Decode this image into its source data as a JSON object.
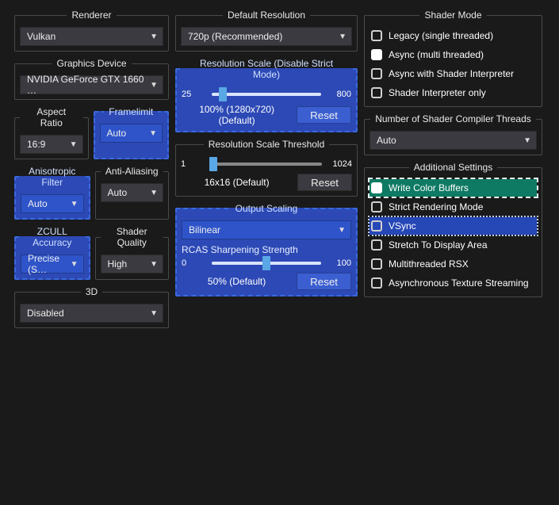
{
  "col1": {
    "renderer": {
      "legend": "Renderer",
      "value": "Vulkan"
    },
    "graphics_device": {
      "legend": "Graphics Device",
      "value": "NVIDIA GeForce GTX 1660 …"
    },
    "aspect": {
      "legend": "Aspect Ratio",
      "value": "16:9"
    },
    "framelimit": {
      "legend": "Framelimit",
      "value": "Auto"
    },
    "aniso": {
      "legend": "Anisotropic Filter",
      "value": "Auto"
    },
    "aa": {
      "legend": "Anti-Aliasing",
      "value": "Auto"
    },
    "zcull": {
      "legend": "ZCULL Accuracy",
      "value": "Precise (S…"
    },
    "shader_q": {
      "legend": "Shader Quality",
      "value": "High"
    },
    "three_d": {
      "legend": "3D",
      "value": "Disabled"
    }
  },
  "col2": {
    "default_res": {
      "legend": "Default Resolution",
      "value": "720p (Recommended)"
    },
    "res_scale": {
      "legend": "Resolution Scale (Disable Strict Mode)",
      "min": "25",
      "max": "800",
      "status": "100% (1280x720) (Default)",
      "reset": "Reset"
    },
    "res_thresh": {
      "legend": "Resolution Scale Threshold",
      "min": "1",
      "max": "1024",
      "status": "16x16 (Default)",
      "reset": "Reset"
    },
    "output": {
      "legend": "Output Scaling",
      "mode": "Bilinear",
      "rcas_label": "RCAS Sharpening Strength",
      "min": "0",
      "max": "100",
      "status": "50% (Default)",
      "reset": "Reset"
    }
  },
  "col3": {
    "shader_mode": {
      "legend": "Shader Mode",
      "opts": [
        "Legacy (single threaded)",
        "Async (multi threaded)",
        "Async with Shader Interpreter",
        "Shader Interpreter only"
      ],
      "selected": 1
    },
    "threads": {
      "legend": "Number of Shader Compiler Threads",
      "value": "Auto"
    },
    "additional": {
      "legend": "Additional Settings",
      "items": [
        {
          "label": "Write Color Buffers",
          "state": "green"
        },
        {
          "label": "Strict Rendering Mode",
          "state": "off"
        },
        {
          "label": "VSync",
          "state": "blue"
        },
        {
          "label": "Stretch To Display Area",
          "state": "off"
        },
        {
          "label": "Multithreaded RSX",
          "state": "off"
        },
        {
          "label": "Asynchronous Texture Streaming",
          "state": "off"
        }
      ]
    }
  },
  "chart_data": {
    "type": "table",
    "title": "GPU Settings sliders",
    "series": [
      {
        "name": "Resolution Scale",
        "min": 25,
        "max": 800,
        "value": 100
      },
      {
        "name": "Resolution Scale Threshold",
        "min": 1,
        "max": 1024,
        "value": 16
      },
      {
        "name": "RCAS Sharpening Strength",
        "min": 0,
        "max": 100,
        "value": 50
      }
    ]
  }
}
